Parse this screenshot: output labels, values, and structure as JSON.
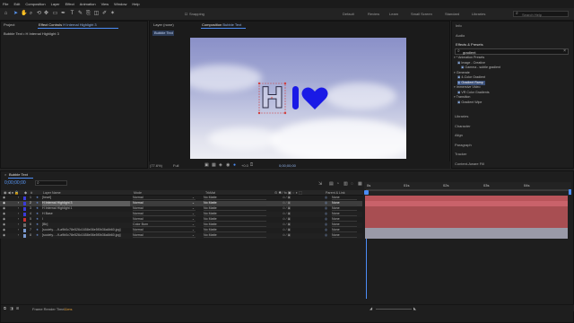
{
  "menu": [
    "File",
    "Edit",
    "Composition",
    "Layer",
    "Effect",
    "Animation",
    "View",
    "Window",
    "Help"
  ],
  "toolbar": {
    "snapping": "Snapping",
    "workspaces": [
      "Default",
      "Review",
      "Learn",
      "Small Screen",
      "Standard",
      "Libraries"
    ],
    "search_placeholder": "Search Help"
  },
  "project_panel": {
    "tab": "Project",
    "effect_controls_tab": "Effect Controls",
    "effect_controls_target": "H Internal Highlight 3",
    "breadcrumb": "Bubble Text • H Internal Highlight 3"
  },
  "layer_panel": {
    "tab": "Layer (none)"
  },
  "composition_panel": {
    "tab": "Composition",
    "tab_name": "Bubble Text",
    "sub_tab": "Bubble Text",
    "zoom": "(77.6%)",
    "resolution": "Full",
    "exposure": "+0.0",
    "timecode": "0;00;00;00"
  },
  "canvas": {
    "letter": "H"
  },
  "right_panel": {
    "info": "Info",
    "audio": "Audio",
    "effects_presets": "Effects & Presets",
    "search_value": "gradient",
    "tree": [
      {
        "label": "* Animation Presets",
        "indent": 0
      },
      {
        "label": "Image - Creative",
        "indent": 1
      },
      {
        "label": "Gamma - subtle gradient",
        "indent": 2
      },
      {
        "label": "Generate",
        "indent": 0
      },
      {
        "label": "4-Color Gradient",
        "indent": 1
      },
      {
        "label": "Gradient Ramp",
        "indent": 1,
        "selected": true
      },
      {
        "label": "Immersive Video",
        "indent": 0
      },
      {
        "label": "VR Color Gradients",
        "indent": 1
      },
      {
        "label": "Transition",
        "indent": 0
      },
      {
        "label": "Gradient Wipe",
        "indent": 1
      }
    ],
    "sections": [
      "Libraries",
      "Character",
      "Align",
      "Paragraph",
      "Tracker",
      "Content-Aware Fill"
    ]
  },
  "timeline": {
    "tab": "Bubble Text",
    "timecode": "0;00;00;00",
    "headers": {
      "layer_name": "Layer Name",
      "mode": "Mode",
      "trkmat": "TrkMat",
      "parent": "Parent & Link"
    },
    "ruler_labels": [
      "0s",
      "01s",
      "02s",
      "03s",
      "04s"
    ],
    "layers": [
      {
        "num": "1",
        "name": "[heart]",
        "mode": "Normal",
        "trkmat": "No Matte",
        "parent": "None",
        "label_color": "#3b3bd8",
        "bar_color": "#b8545a"
      },
      {
        "num": "2",
        "name": "H Internal Highlight 3",
        "mode": "Normal",
        "trkmat": "No Matte",
        "parent": "None",
        "label_color": "#3b3bd8",
        "bar_color": "#b8545a",
        "selected": true
      },
      {
        "num": "3",
        "name": "H Internal Highlight 1",
        "mode": "Normal",
        "trkmat": "No Matte",
        "parent": "None",
        "label_color": "#3b3bd8",
        "bar_color": "#a84e52"
      },
      {
        "num": "4",
        "name": "H Base",
        "mode": "Normal",
        "trkmat": "No Matte",
        "parent": "None",
        "label_color": "#3b3bd8",
        "bar_color": "#a84e52"
      },
      {
        "num": "5",
        "name": "I",
        "mode": "Normal",
        "trkmat": "No Matte",
        "parent": "None",
        "label_color": "#c83030",
        "bar_color": "#a84e52"
      },
      {
        "num": "6",
        "name": "[Bb]",
        "mode": "Color Burn",
        "trkmat": "No Matte",
        "parent": "None",
        "label_color": "#6a6a6a",
        "bar_color": "#a84e52"
      },
      {
        "num": "7",
        "name": "[society…-9-a9b0c78e526c1658e06e5f0b36a6b60.jpg]",
        "mode": "Normal",
        "trkmat": "No Matte",
        "parent": "None",
        "label_color": "#7a9ad0",
        "bar_color": "#9a9aa8"
      },
      {
        "num": "8",
        "name": "[society…-9-a9b0c78e526c1658e06e5f0b36a6b60.jpg]",
        "mode": "Normal",
        "trkmat": "No Matte",
        "parent": "None",
        "label_color": "#7a9ad0",
        "bar_color": "#9a9aa8"
      }
    ],
    "frame_render_label": "Frame Render Time",
    "frame_render_value": "11ms"
  }
}
